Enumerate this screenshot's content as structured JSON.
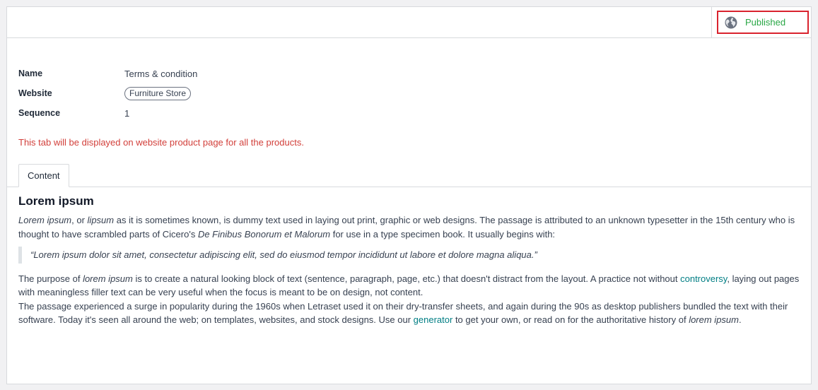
{
  "header": {
    "publish_button": {
      "icon": "globe-icon",
      "label": "Published",
      "color": "#28a745",
      "highlight_color": "#d9232e"
    }
  },
  "form": {
    "fields": [
      {
        "label": "Name",
        "value": "Terms & condition"
      },
      {
        "label": "Website",
        "value": "Furniture Store"
      },
      {
        "label": "Sequence",
        "value": "1"
      }
    ],
    "notice": "This tab will be displayed on website product page for all the products.",
    "notice_color": "#d23f3a"
  },
  "tabs": [
    {
      "label": "Content",
      "active": true
    }
  ],
  "content": {
    "heading": "Lorem ipsum",
    "p1": {
      "em1": "Lorem ipsum",
      "t1": ", or ",
      "em2": "lipsum",
      "t2": " as it is sometimes known, is dummy text used in laying out print, graphic or web designs. The passage is attributed to an unknown typesetter in the 15th century who is thought to have scrambled parts of Cicero's ",
      "em3": "De Finibus Bonorum et Malorum",
      "t3": " for use in a type specimen book. It usually begins with:"
    },
    "quote": "“Lorem ipsum dolor sit amet, consectetur adipiscing elit, sed do eiusmod tempor incididunt ut labore et dolore magna aliqua.”",
    "p2": {
      "t1": "The purpose of ",
      "em1": "lorem ipsum",
      "t2": " is to create a natural looking block of text (sentence, paragraph, page, etc.) that doesn't distract from the layout. A practice not without ",
      "link": "controversy",
      "t3": ", laying out pages with meaningless filler text can be very useful when the focus is meant to be on design, not content."
    },
    "p3": {
      "t1": "The passage experienced a surge in popularity during the 1960s when Letraset used it on their dry-transfer sheets, and again during the 90s as desktop publishers bundled the text with their software. Today it's seen all around the web; on templates, websites, and stock designs. Use our ",
      "link": "generator",
      "t2": " to get your own, or read on for the authoritative history of ",
      "em1": "lorem ipsum",
      "t3": "."
    },
    "link_color": "#017e84"
  }
}
